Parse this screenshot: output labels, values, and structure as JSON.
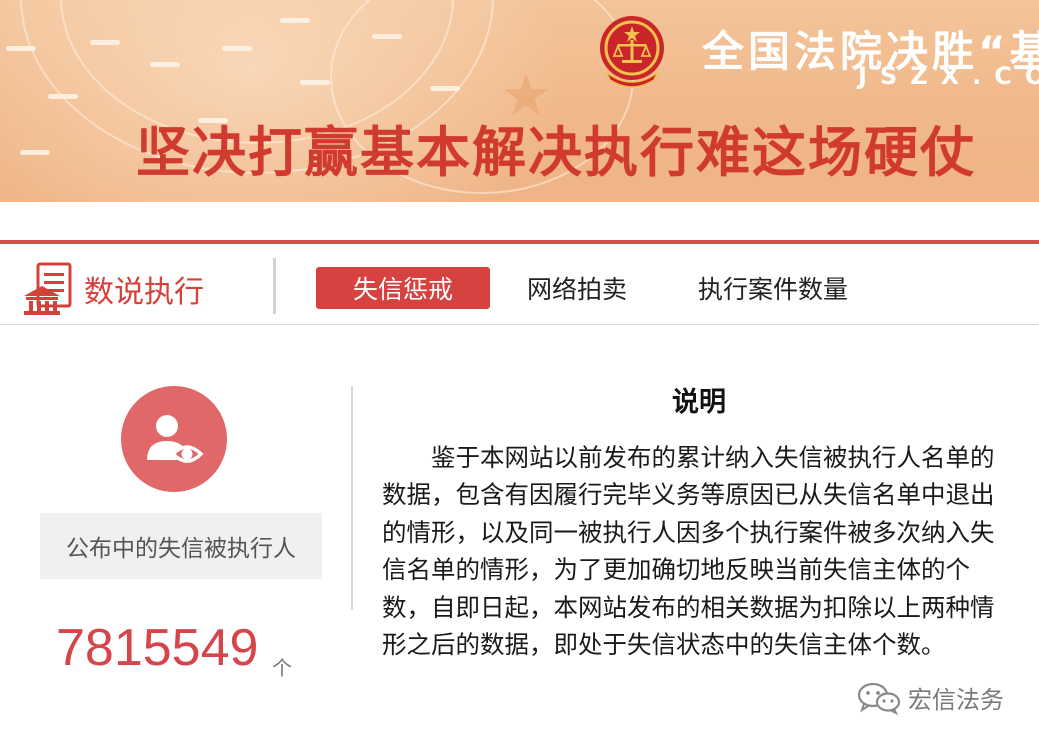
{
  "banner": {
    "title": "全国法院决胜“基",
    "url": "JSZX.CO",
    "slogan": "坚决打赢基本解决执行难这场硬仗",
    "emblem_icon": "court-emblem-icon"
  },
  "nav": {
    "brand_icon": "courthouse-document-icon",
    "brand_title": "数说执行",
    "tabs": [
      {
        "label": "失信惩戒",
        "active": true
      },
      {
        "label": "网络拍卖",
        "active": false
      },
      {
        "label": "执行案件数量",
        "active": false
      }
    ]
  },
  "stat": {
    "icon": "person-eye-icon",
    "label": "公布中的失信被执行人",
    "value": "7815549",
    "unit": "个"
  },
  "explanation": {
    "title": "说明",
    "body": "鉴于本网站以前发布的累计纳入失信被执行人名单的数据，包含有因履行完毕义务等原因已从失信名单中退出的情形，以及同一被执行人因多个执行案件被多次纳入失信名单的情形，为了更加确切地反映当前失信主体的个数，自即日起，本网站发布的相关数据为扣除以上两种情形之后的数据，即处于失信状态中的失信主体个数。"
  },
  "watermark": {
    "icon": "wechat-icon",
    "text": "宏信法务"
  },
  "colors": {
    "accent_red": "#d54240",
    "banner_peach": "#f0b88a",
    "stat_red": "#d6454a"
  }
}
